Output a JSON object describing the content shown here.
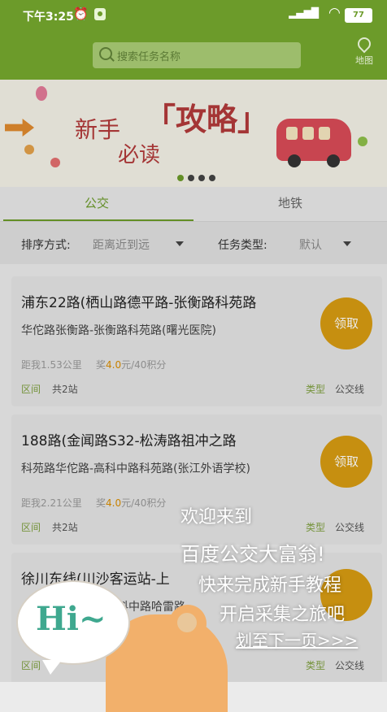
{
  "status_bar": {
    "time": "下午3:25",
    "battery": "77"
  },
  "header": {
    "search_placeholder": "搜索任务名称",
    "map_label": "地图"
  },
  "banner": {
    "line1": "新手",
    "big": "「攻略」",
    "line2": "必读",
    "pages": 4,
    "active_page": 0
  },
  "tabs": [
    {
      "label": "公交",
      "active": true
    },
    {
      "label": "地铁",
      "active": false
    }
  ],
  "filter": {
    "sort_label": "排序方式:",
    "sort_value": "距离近到远",
    "type_label": "任务类型:",
    "type_value": "默认"
  },
  "tasks": [
    {
      "title": "浦东22路(栖山路德平路-张衡路科苑路",
      "subtitle": "华佗路张衡路-张衡路科苑路(曙光医院)",
      "distance": "距我1.53公里",
      "reward_prefix": "奖",
      "reward_amount": "4.0",
      "reward_suffix": "元/40积分",
      "section_label": "区间",
      "stations": "共2站",
      "type_label": "类型",
      "type_value": "公交线",
      "claim": "领取"
    },
    {
      "title": "188路(金闻路S32-松涛路祖冲之路",
      "subtitle": "科苑路华佗路-高科中路科苑路(张江外语学校)",
      "distance": "距我2.21公里",
      "reward_prefix": "奖",
      "reward_amount": "4.0",
      "reward_suffix": "元/40积分",
      "section_label": "区间",
      "stations": "共2站",
      "type_label": "类型",
      "type_value": "公交线",
      "claim": "领取"
    },
    {
      "title": "徐川东线(川沙客运站-上",
      "subtitle": "科中路哈雷路",
      "section_label": "区间",
      "type_label": "类型",
      "type_value": "公交线"
    }
  ],
  "onboarding": {
    "hi": "Hi~",
    "line1": "欢迎来到",
    "line2": "百度公交大富翁!",
    "line3": "快来完成新手教程",
    "line4": "开启采集之旅吧",
    "next": "划至下一页>>>"
  },
  "colors": {
    "brand_green": "#6c9b2a",
    "claim_gold": "#d79c12",
    "reward_orange": "#d98d00"
  }
}
